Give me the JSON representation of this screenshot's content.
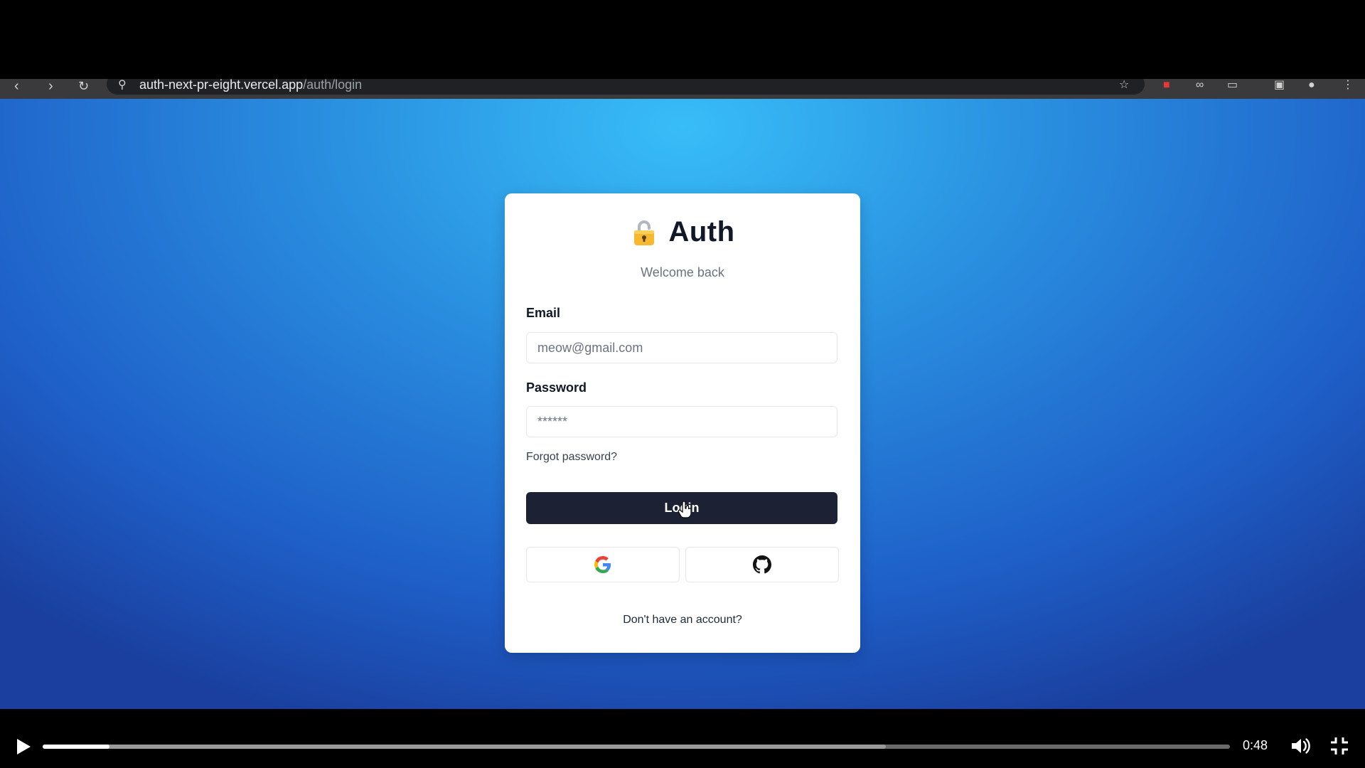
{
  "browser": {
    "url_host": "auth-next-pr-eight.vercel.app",
    "url_path": "/auth/login"
  },
  "card": {
    "brand_title": "Auth",
    "subtitle": "Welcome back",
    "email_label": "Email",
    "email_placeholder": "meow@gmail.com",
    "password_label": "Password",
    "password_placeholder": "******",
    "forgot_link": "Forgot password?",
    "login_button": "Login",
    "signup_link": "Don't have an account?"
  },
  "video": {
    "time": "0:48",
    "progress_fraction": 0.056,
    "buffered_fraction": 0.71
  },
  "colors": {
    "bg_light": "#38bdf8",
    "bg_dark": "#1e40af",
    "button_dark": "#1c2233"
  }
}
